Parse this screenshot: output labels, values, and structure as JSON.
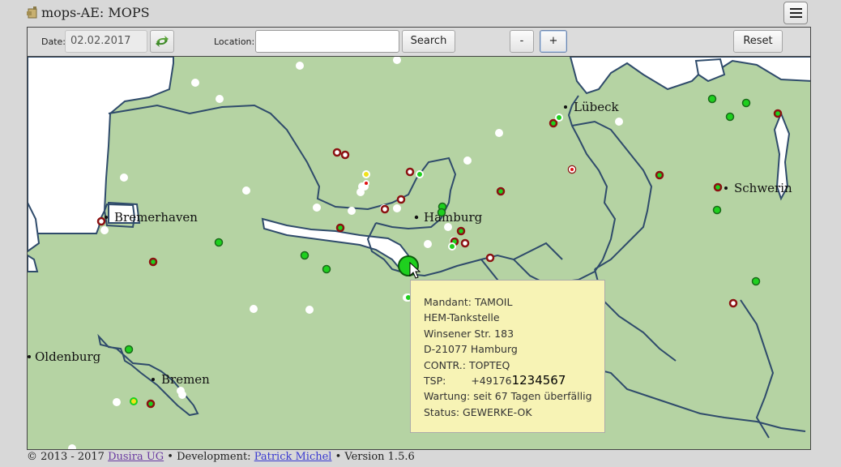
{
  "window": {
    "title": "mops-AE: MOPS"
  },
  "toolbar": {
    "date_label": "Date:",
    "date_value": "02.02.2017",
    "location_label": "Location:",
    "location_value": "",
    "search_label": "Search",
    "zoom_out_label": "-",
    "zoom_in_label": "+",
    "reset_label": "Reset"
  },
  "colors": {
    "land": "#b5d3a3",
    "water": "#ffffff",
    "border": "#2f4b6b",
    "marker_green": "#1ed01e",
    "marker_red": "#8b1111",
    "marker_yellow": "#f2e21a",
    "tooltip_bg": "#f7f3b5"
  },
  "map": {
    "cities": [
      "Bremerhaven",
      "Hamburg",
      "Lübeck",
      "Schwerin",
      "Oldenburg",
      "Bremen"
    ],
    "marker_counts": {
      "green": 22,
      "red_outline": 20,
      "white": 27,
      "yellow": 3
    }
  },
  "tooltip": {
    "mandant": "Mandant: TAMOIL",
    "name": "HEM-Tankstelle",
    "street": "Winsener Str. 183",
    "city": "D-21077 Hamburg",
    "contractor": "CONTR.:  TOPTEQ",
    "tsp_label": "TSP:",
    "tsp_prefix": "+49176",
    "tsp_number": "1234567",
    "wartung": "Wartung: seit 67 Tagen überfällig",
    "status": "Status:    GEWERKE-OK"
  },
  "footer": {
    "copyright": "© 2013 - 2017 ",
    "company": "Dusira UG",
    "dev_prefix": " • Development: ",
    "developer": "Patrick Michel",
    "version": " • Version 1.5.6"
  }
}
